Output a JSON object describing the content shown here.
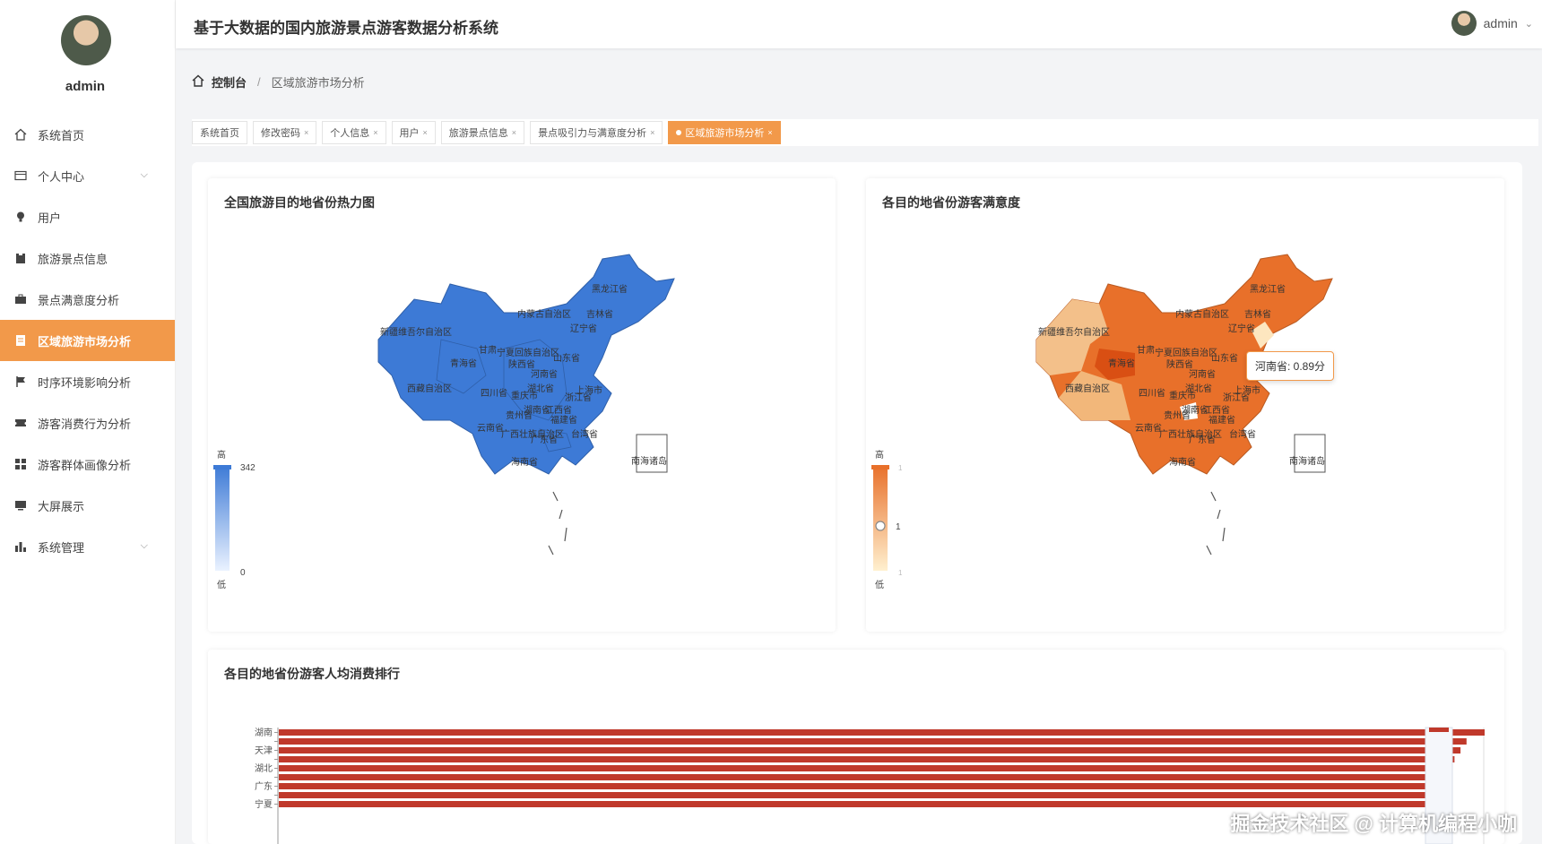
{
  "app": {
    "title": "基于大数据的国内旅游景点游客数据分析系统",
    "user": "admin"
  },
  "sidebar": {
    "username": "admin",
    "items": [
      {
        "label": "系统首页",
        "icon": "home-icon",
        "chevron": false,
        "active": false
      },
      {
        "label": "个人中心",
        "icon": "id-card-icon",
        "chevron": true,
        "active": false
      },
      {
        "label": "用户",
        "icon": "user-bulb-icon",
        "chevron": false,
        "active": false
      },
      {
        "label": "旅游景点信息",
        "icon": "clipboard-icon",
        "chevron": false,
        "active": false
      },
      {
        "label": "景点满意度分析",
        "icon": "briefcase-icon",
        "chevron": false,
        "active": false
      },
      {
        "label": "区域旅游市场分析",
        "icon": "document-icon",
        "chevron": false,
        "active": true
      },
      {
        "label": "时序环境影响分析",
        "icon": "flag-icon",
        "chevron": false,
        "active": false
      },
      {
        "label": "游客消费行为分析",
        "icon": "ticket-icon",
        "chevron": false,
        "active": false
      },
      {
        "label": "游客群体画像分析",
        "icon": "grid-icon",
        "chevron": false,
        "active": false
      },
      {
        "label": "大屏展示",
        "icon": "monitor-icon",
        "chevron": false,
        "active": false
      },
      {
        "label": "系统管理",
        "icon": "bar-chart-icon",
        "chevron": true,
        "active": false
      }
    ]
  },
  "breadcrumb": {
    "home": "控制台",
    "separator": "/",
    "current": "区域旅游市场分析"
  },
  "tags": [
    {
      "label": "系统首页",
      "closable": false,
      "active": false
    },
    {
      "label": "修改密码",
      "closable": true,
      "active": false
    },
    {
      "label": "个人信息",
      "closable": true,
      "active": false
    },
    {
      "label": "用户",
      "closable": true,
      "active": false
    },
    {
      "label": "旅游景点信息",
      "closable": true,
      "active": false
    },
    {
      "label": "景点吸引力与满意度分析",
      "closable": true,
      "active": false
    },
    {
      "label": "区域旅游市场分析",
      "closable": true,
      "active": true
    }
  ],
  "charts": {
    "heatmap": {
      "title": "全国旅游目的地省份热力图",
      "legend": {
        "high": "高",
        "low": "低",
        "max": "342",
        "min": "0"
      },
      "color": "#3d7ad6"
    },
    "satisfaction": {
      "title": "各目的地省份游客满意度",
      "legend": {
        "high": "高",
        "low": "低",
        "mid": "1",
        "top": "1",
        "bottom": "1"
      },
      "tooltip": "河南省: 0.89分",
      "color": "#e8702a"
    },
    "ranking": {
      "title": "各目的地省份游客人均消费排行"
    }
  },
  "map_labels": {
    "xinjiang": "新疆维吾尔自治区",
    "xizang": "西藏自治区",
    "qinghai": "青海省",
    "neimenggu": "内蒙古自治区",
    "heilongjiang": "黑龙江省",
    "jilin": "吉林省",
    "liaoning": "辽宁省",
    "gansu": "甘肃",
    "ningxia": "宁夏回族自治区",
    "shanxi": "陕西省",
    "shandong": "山东省",
    "henan": "河南省",
    "sichuan": "四川省",
    "hubei": "湖北省",
    "chongqing": "重庆市",
    "guizhou": "贵州省",
    "hunan": "湖南省",
    "jiangxi": "江西省",
    "zhejiang": "浙江省",
    "fujian": "福建省",
    "yunnan": "云南省",
    "guangxi": "广西壮族自治区",
    "guangdong": "广东省",
    "hainan": "海南省",
    "taiwan": "台湾省",
    "shanghai": "上海市",
    "south_sea": "南海诸岛"
  },
  "chart_data": {
    "type": "bar",
    "orientation": "horizontal",
    "title": "各目的地省份游客人均消费排行",
    "categories": [
      "湖南",
      "",
      "天津",
      "",
      "湖北",
      "",
      "广东",
      "",
      "宁夏"
    ],
    "values": [
      1,
      0.985,
      0.98,
      0.975,
      0.97,
      0.965,
      0.96,
      0.957,
      0.955
    ],
    "color": "#c0392b",
    "xlabel": "",
    "ylabel": ""
  },
  "watermark": "掘金技术社区 @ 计算机编程小咖"
}
